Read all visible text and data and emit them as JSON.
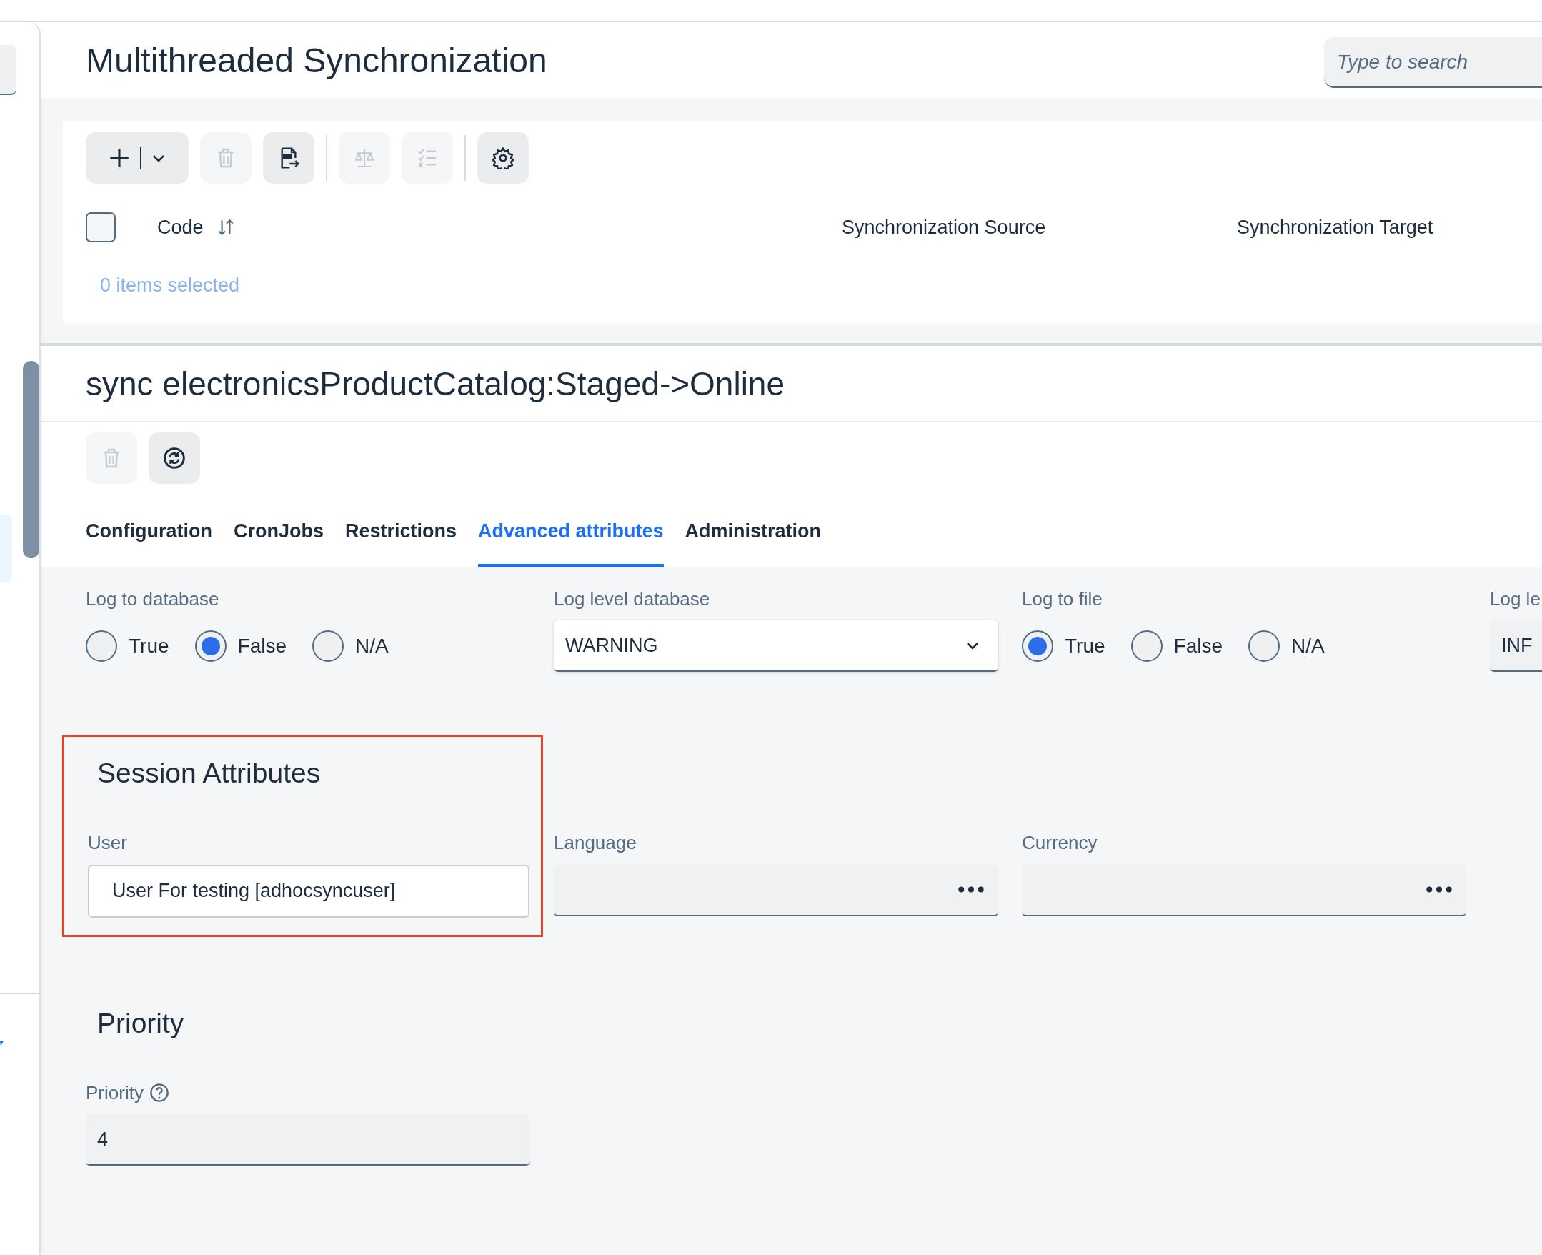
{
  "header": {
    "title": "Multithreaded Synchronization",
    "search": {
      "placeholder": "Type to search"
    }
  },
  "toolbar": [
    {
      "kind": "split",
      "disabled": false
    },
    {
      "kind": "delete",
      "disabled": true
    },
    {
      "kind": "csv",
      "disabled": false
    },
    {
      "kind": "separator"
    },
    {
      "kind": "compare",
      "disabled": true
    },
    {
      "kind": "checklist",
      "disabled": true
    },
    {
      "kind": "separator"
    },
    {
      "kind": "settings",
      "disabled": false
    }
  ],
  "table": {
    "select_all": {
      "checked": false
    },
    "columns": [
      {
        "label": "Code",
        "sortable": true
      },
      {
        "label": "Synchronization Source",
        "sortable": false
      },
      {
        "label": "Synchronization Target",
        "sortable": false
      }
    ],
    "selection_count": "0 items selected"
  },
  "editor": {
    "title": "sync electronicsProductCatalog:Staged->Online",
    "actions": [
      {
        "kind": "delete",
        "disabled": true
      },
      {
        "kind": "sync",
        "disabled": false
      }
    ],
    "tabs": [
      {
        "label": "Configuration",
        "selected": false
      },
      {
        "label": "CronJobs",
        "selected": false
      },
      {
        "label": "Restrictions",
        "selected": false
      },
      {
        "label": "Advanced attributes",
        "selected": true
      },
      {
        "label": "Administration",
        "selected": false
      }
    ],
    "fields": [
      {
        "kind": "radio",
        "label": "Log to database",
        "options": [
          {
            "label": "True",
            "selected": false
          },
          {
            "label": "False",
            "selected": true
          },
          {
            "label": "N/A",
            "selected": false
          }
        ]
      },
      {
        "kind": "select",
        "label": "Log level database",
        "value": "WARNING"
      },
      {
        "kind": "radio",
        "label": "Log to file",
        "options": [
          {
            "label": "True",
            "selected": true
          },
          {
            "label": "False",
            "selected": false
          },
          {
            "label": "N/A",
            "selected": false
          }
        ]
      },
      {
        "kind": "number",
        "label": "Log le",
        "value": "INF"
      }
    ],
    "session_attributes": {
      "title": "Session Attributes",
      "highlighted": true,
      "fields": [
        {
          "kind": "text",
          "label": "User",
          "value": "User For testing [adhocsyncuser]"
        },
        {
          "kind": "reference",
          "label": "Language"
        },
        {
          "kind": "reference",
          "label": "Currency"
        }
      ]
    },
    "priority": {
      "title": "Priority",
      "fields": [
        {
          "kind": "number",
          "label": "Priority",
          "help": true,
          "value": "4"
        }
      ]
    }
  }
}
